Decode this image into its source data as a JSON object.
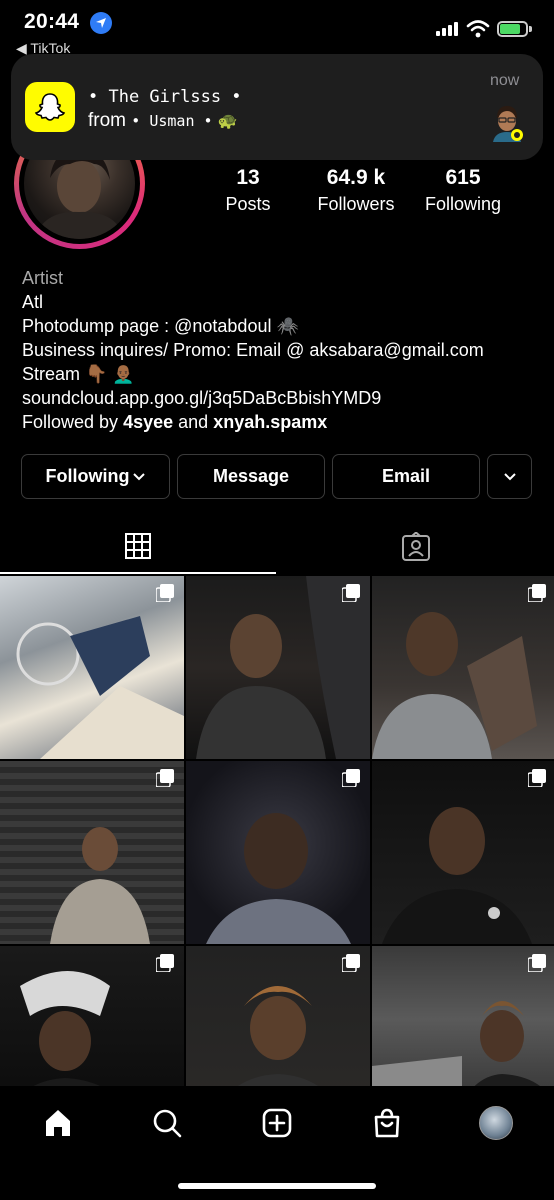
{
  "status_bar": {
    "time": "20:44",
    "back_app": "◀ TikTok"
  },
  "notification": {
    "title": "• The Girlsss •",
    "from_prefix": "from",
    "from_name": "• Usman •",
    "time": "now",
    "app_icon": "snapchat-ghost-icon"
  },
  "profile": {
    "stats": [
      {
        "value": "13",
        "label": "Posts"
      },
      {
        "value": "64.9 k",
        "label": "Followers"
      },
      {
        "value": "615",
        "label": "Following"
      }
    ],
    "category": "Artist",
    "bio_lines": [
      "Atl",
      "Photodump page : @notabdoul 🕷️",
      "Business inquires/ Promo: Email @ aksabara@gmail.com",
      "Stream 👇🏾 👨🏾‍🦲"
    ],
    "link": "soundcloud.app.goo.gl/j3q5DaBcBbishYMD9",
    "followed_by_prefix": "Followed by",
    "followed_by_1": "4syee",
    "followed_by_and": "and",
    "followed_by_2": "xnyah.spamx"
  },
  "actions": {
    "following": "Following",
    "message": "Message",
    "email": "Email"
  },
  "tabs": [
    "grid-icon",
    "tagged-icon"
  ],
  "nav": [
    "home-icon",
    "search-icon",
    "new-post-icon",
    "shop-icon",
    "profile-avatar"
  ],
  "colors": {
    "accent": "#2f7cf6",
    "snapchat": "#fffc00",
    "story_ring": "#dd2a7b"
  }
}
